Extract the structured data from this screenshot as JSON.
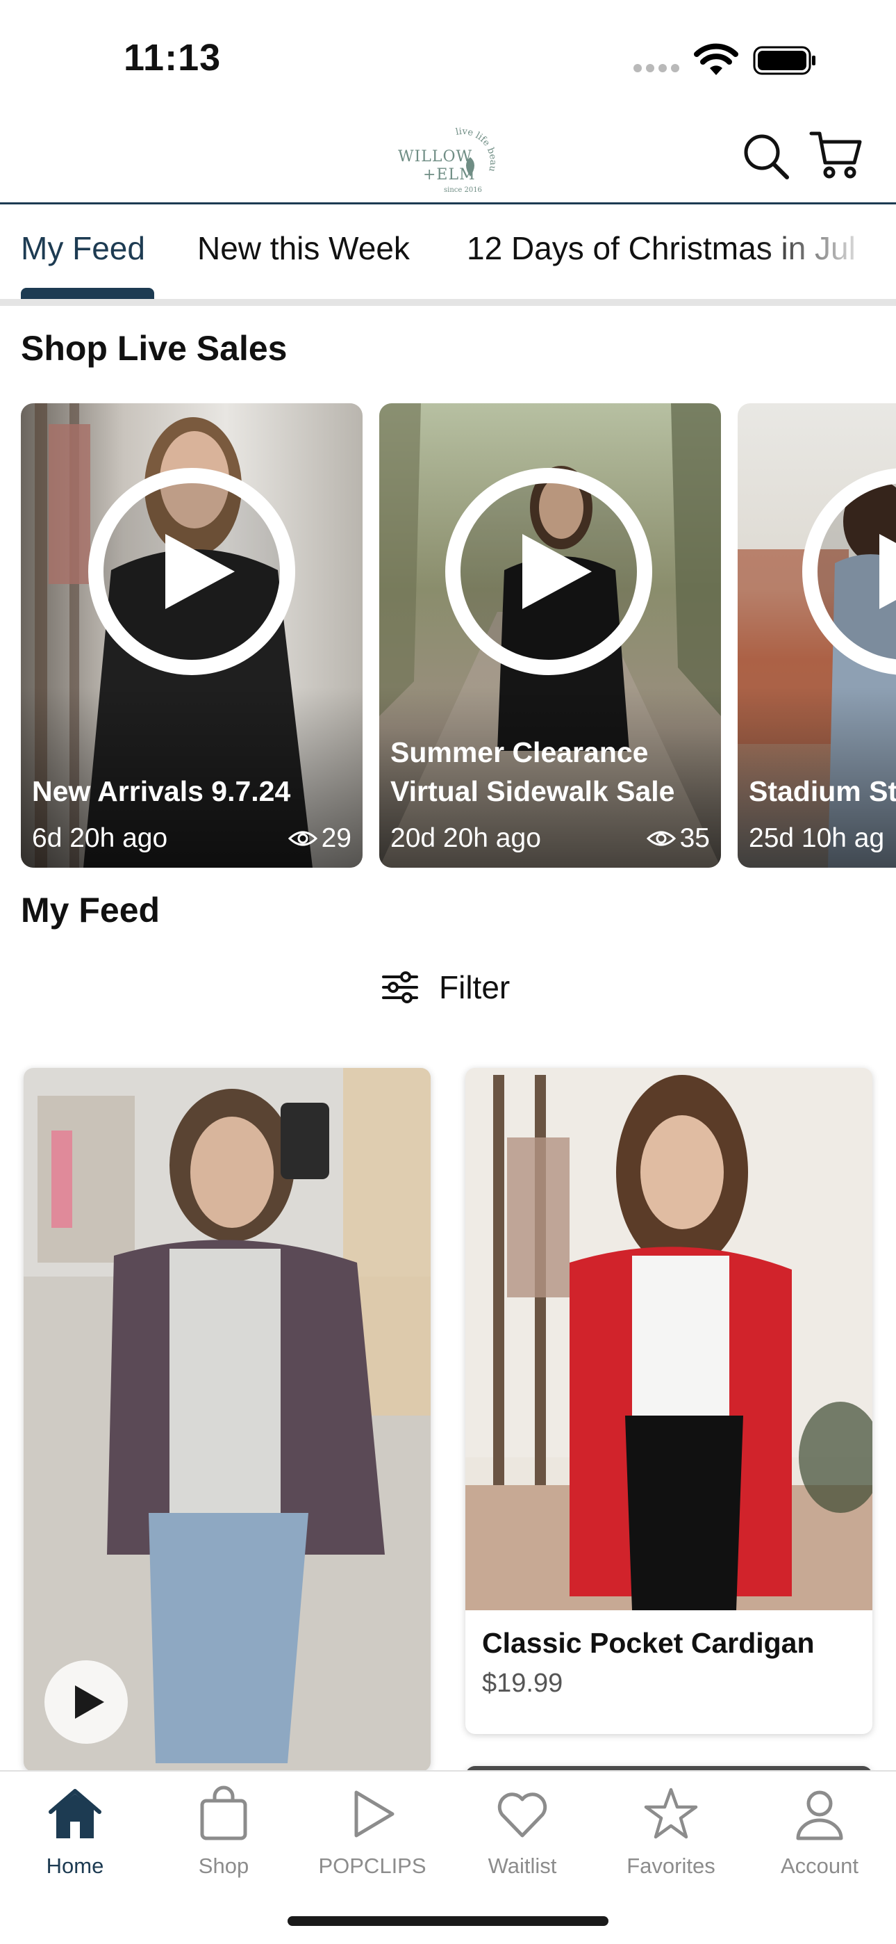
{
  "status_bar": {
    "time": "11:13"
  },
  "header": {
    "logo_text": {
      "line1": "WILLOW",
      "line2": "+ELM",
      "arc": "live life beautifully",
      "since": "since 2016"
    },
    "search_label": "Search",
    "cart_label": "Cart"
  },
  "tabs": [
    {
      "label": "My Feed",
      "active": true
    },
    {
      "label": "New this Week",
      "active": false
    },
    {
      "label": "12 Days of Christmas in Jul",
      "active": false
    }
  ],
  "live_section": {
    "title": "Shop Live Sales",
    "cards": [
      {
        "title_line1": "",
        "title_line2": "New Arrivals 9.7.24",
        "age": "6d 20h ago",
        "views": "29"
      },
      {
        "title_line1": "Summer Clearance",
        "title_line2": "Virtual Sidewalk Sale",
        "age": "20d 20h ago",
        "views": "35"
      },
      {
        "title_line1": "",
        "title_line2": "Stadium St",
        "age": "25d 10h ag",
        "views": ""
      }
    ]
  },
  "feed_section": {
    "title": "My Feed",
    "filter_label": "Filter",
    "products": [
      {
        "title": "Classic Pocket Cardigan",
        "price": "$19.99"
      }
    ]
  },
  "bottom_nav": [
    {
      "label": "Home",
      "icon": "home-icon",
      "active": true
    },
    {
      "label": "Shop",
      "icon": "shopping-bag-icon",
      "active": false
    },
    {
      "label": "POPCLIPS",
      "icon": "play-icon",
      "active": false
    },
    {
      "label": "Waitlist",
      "icon": "heart-icon",
      "active": false
    },
    {
      "label": "Favorites",
      "icon": "star-icon",
      "active": false
    },
    {
      "label": "Account",
      "icon": "person-icon",
      "active": false
    }
  ],
  "colors": {
    "brand_navy": "#1d3b52",
    "inactive_gray": "#8c8c8c",
    "logo_green": "#6f8d84"
  }
}
